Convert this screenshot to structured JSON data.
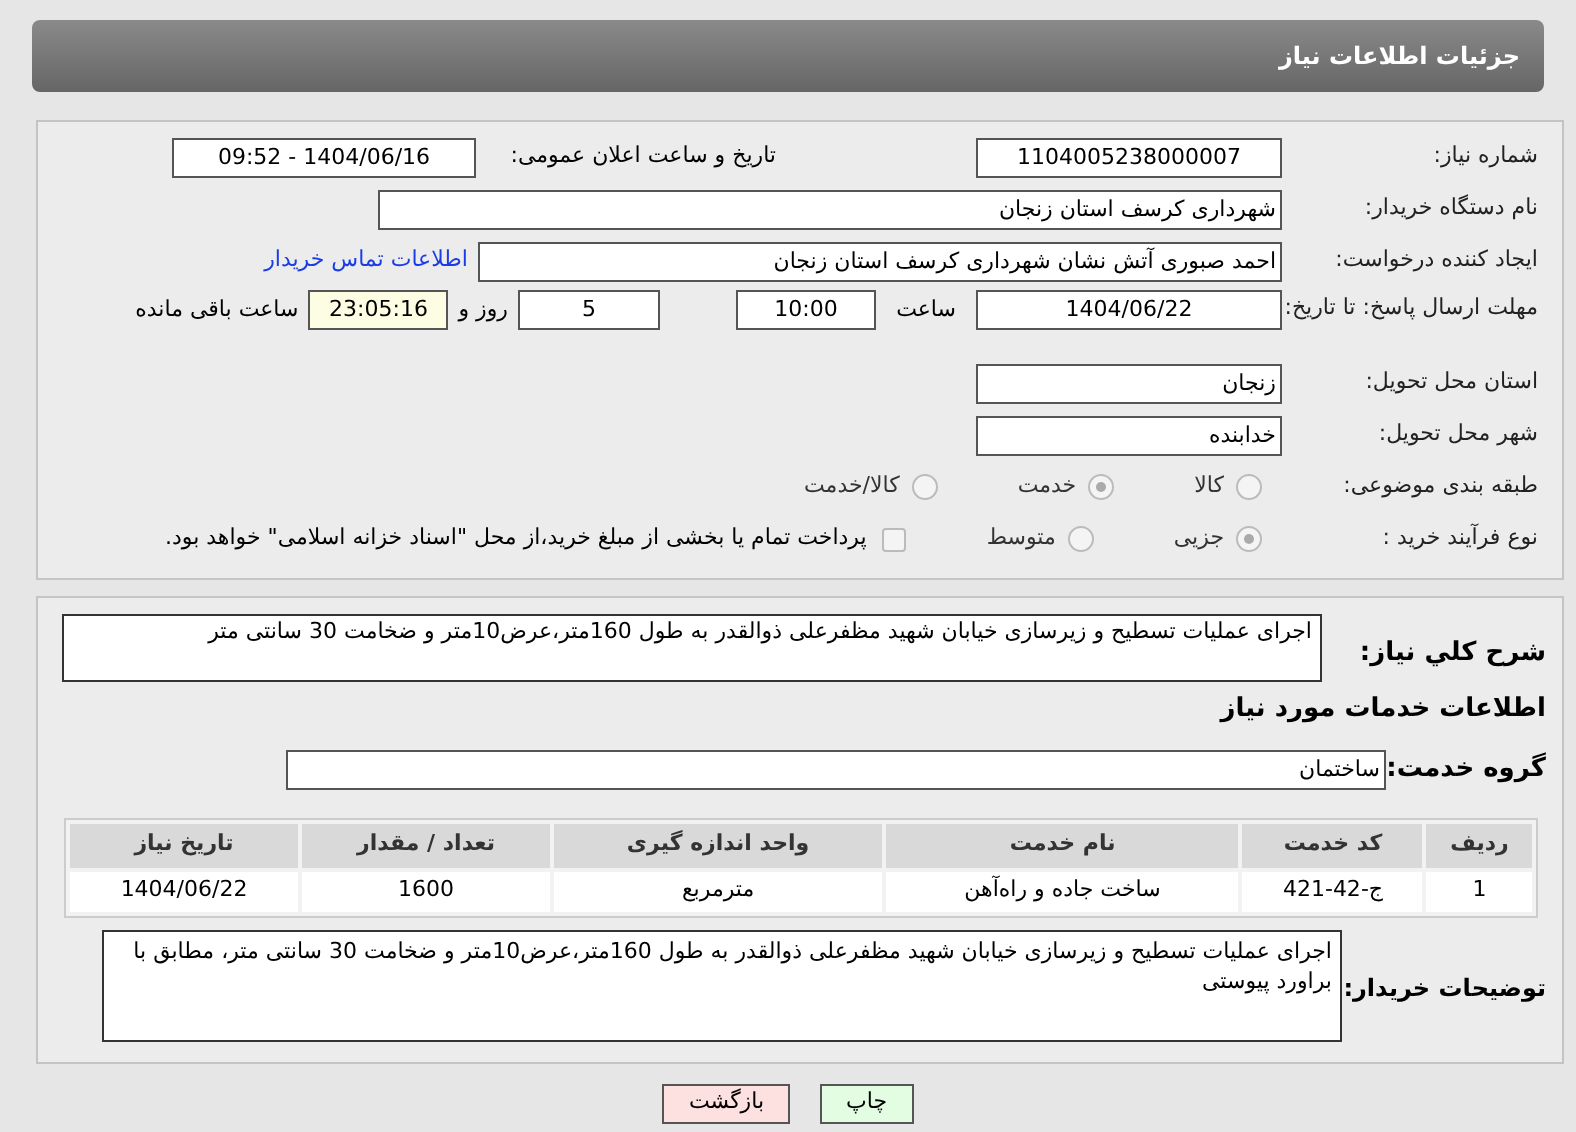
{
  "header": {
    "title": "جزئیات اطلاعات نیاز"
  },
  "need_number": {
    "label": "شماره نیاز:",
    "value": "1104005238000007"
  },
  "announce": {
    "label": "تاریخ و ساعت اعلان عمومی:",
    "value": "1404/06/16 - 09:52"
  },
  "buyer_org": {
    "label": "نام دستگاه خریدار:",
    "value": "شهرداری کرسف استان زنجان"
  },
  "requester": {
    "label": "ایجاد کننده درخواست:",
    "value": "احمد صبوری آتش نشان شهرداری کرسف استان زنجان",
    "link": "اطلاعات تماس خریدار"
  },
  "deadline": {
    "label": "مهلت ارسال پاسخ: تا تاریخ:",
    "date": "1404/06/22",
    "time_label": "ساعت",
    "time": "10:00",
    "days": "5",
    "days_label": "روز و",
    "remaining": "23:05:16",
    "remaining_label": "ساعت باقی مانده"
  },
  "province": {
    "label": "استان محل تحویل:",
    "value": "زنجان"
  },
  "city": {
    "label": "شهر محل تحویل:",
    "value": "خدابنده"
  },
  "category": {
    "label": "طبقه بندی موضوعی:",
    "options": [
      {
        "label": "کالا",
        "selected": false
      },
      {
        "label": "خدمت",
        "selected": true
      },
      {
        "label": "کالا/خدمت",
        "selected": false
      }
    ]
  },
  "purchase": {
    "label": "نوع فرآیند خرید :",
    "options": [
      {
        "label": "جزیی",
        "selected": true
      },
      {
        "label": "متوسط",
        "selected": false
      }
    ],
    "checkbox": {
      "label": "پرداخت تمام یا بخشی از مبلغ خرید،از محل \"اسناد خزانه اسلامی\" خواهد بود.",
      "checked": false
    }
  },
  "description": {
    "label": "شرح کلي نیاز:",
    "value": "اجرای عملیات تسطیح و زیرسازی خیابان شهید مظفرعلی ذوالقدر به طول 160متر،عرض10متر و ضخامت 30 سانتی متر"
  },
  "services_title": "اطلاعات خدمات مورد نیاز",
  "service_group": {
    "label": "گروه خدمت:",
    "value": "ساختمان"
  },
  "table": {
    "columns": [
      "ردیف",
      "کد خدمت",
      "نام خدمت",
      "واحد اندازه گیری",
      "تعداد / مقدار",
      "تاریخ نیاز"
    ],
    "rows": [
      [
        "1",
        "ج-42-421",
        "ساخت جاده و راه‌آهن",
        "مترمربع",
        "1600",
        "1404/06/22"
      ]
    ]
  },
  "buyer_notes": {
    "label": "توضیحات خریدار:",
    "value": "اجرای عملیات تسطیح و زیرسازی خیابان شهید مظفرعلی ذوالقدر به طول 160متر،عرض10متر و ضخامت 30 سانتی متر، مطابق با براورد پیوستی"
  },
  "buttons": [
    {
      "label": "چاپ",
      "kind": "print"
    },
    {
      "label": "بازگشت",
      "kind": "back"
    }
  ]
}
